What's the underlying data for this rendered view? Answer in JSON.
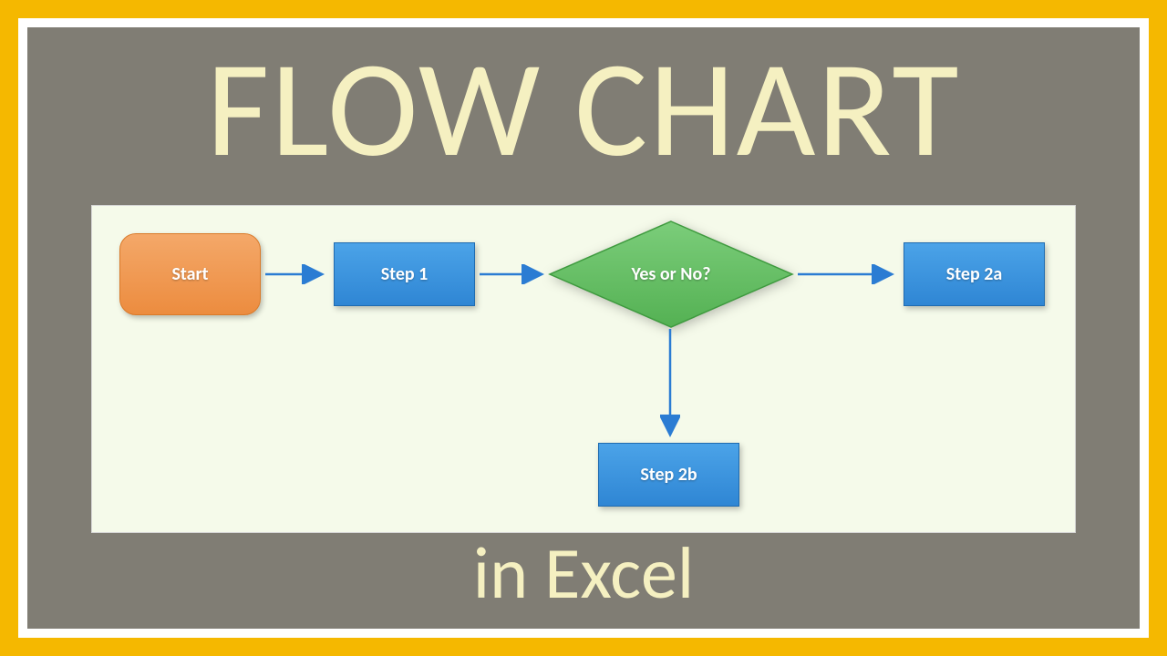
{
  "title": "FLOW CHART",
  "subtitle": "in Excel",
  "nodes": {
    "start": {
      "label": "Start"
    },
    "step1": {
      "label": "Step 1"
    },
    "decision": {
      "label": "Yes or No?"
    },
    "step2a": {
      "label": "Step 2a"
    },
    "step2b": {
      "label": "Step 2b"
    }
  },
  "edges": [
    {
      "from": "start",
      "to": "step1"
    },
    {
      "from": "step1",
      "to": "decision"
    },
    {
      "from": "decision",
      "to": "step2a"
    },
    {
      "from": "decision",
      "to": "step2b"
    }
  ],
  "colors": {
    "frame_outer": "#f5b800",
    "panel": "#807d74",
    "canvas": "#f5faea",
    "title_text": "#f5f0c1",
    "start_fill": "#ec8c3f",
    "process_fill": "#2f86d4",
    "decision_fill": "#63be62",
    "arrow": "#2b7cd3"
  }
}
